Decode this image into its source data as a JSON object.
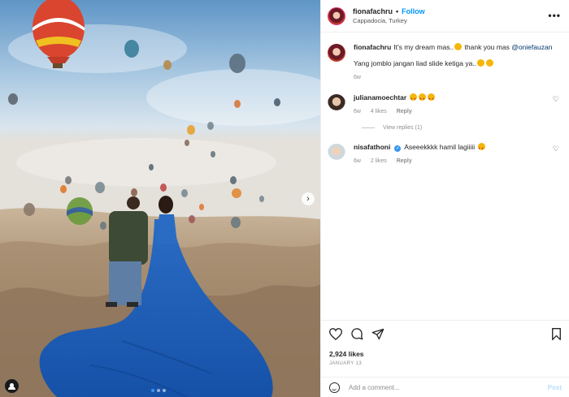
{
  "post": {
    "photo_alt": "",
    "carousel_dots": 3,
    "active_dot": 0,
    "next_glyph": "›"
  },
  "header": {
    "username": "fionafachru",
    "separator": "•",
    "follow": "Follow",
    "location": "Cappadocia, Turkey",
    "more": "•••"
  },
  "caption": {
    "username": "fionafachru",
    "text1": "It's my dream mas..",
    "text2": "thank you mas",
    "mention": "@oniefauzan",
    "line2": "Yang jomblo jangan liad slide ketiga ya..",
    "time": "6w"
  },
  "comments": [
    {
      "username": "julianamoechtar",
      "time": "6w",
      "likes": "4 likes",
      "reply": "Reply"
    },
    {
      "username": "nisafathoni",
      "text": "Aseeekkkk hamil lagiiiii",
      "time": "6w",
      "likes": "2 likes",
      "reply": "Reply"
    }
  ],
  "view_replies": "View replies (1)",
  "actions": {
    "likes": "2,924 likes",
    "date": "JANUARY 13"
  },
  "add_comment": {
    "placeholder": "Add a comment...",
    "post": "Post"
  },
  "colors": {
    "accent": "#0095f6",
    "dress": "#1f5fb8",
    "sky": "#a9c9e2"
  }
}
